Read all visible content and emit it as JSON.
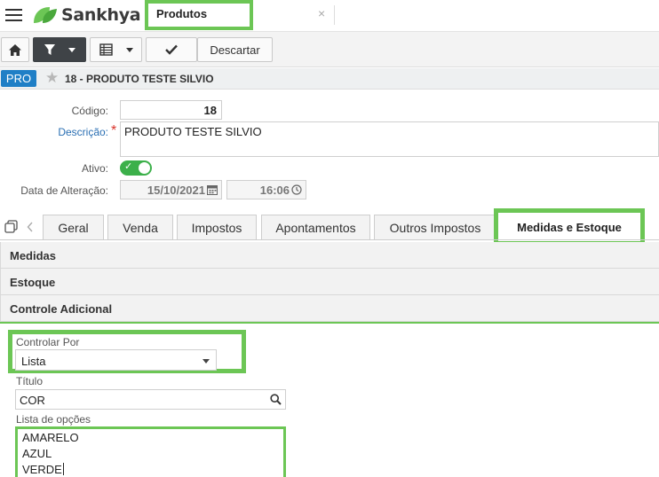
{
  "app": {
    "logo_text": "Sankhya",
    "brand_color": "#6cc655"
  },
  "window_tab": {
    "title": "Produtos",
    "close_glyph": "×"
  },
  "toolbar": {
    "discard_label": "Descartar"
  },
  "record": {
    "badge": "PRO",
    "title": "18 - PRODUTO TESTE SILVIO"
  },
  "form": {
    "codigo": {
      "label": "Código:",
      "value": "18"
    },
    "descricao": {
      "label": "Descrição:",
      "required_mark": "*",
      "value": "PRODUTO TESTE SILVIO"
    },
    "ativo": {
      "label": "Ativo:",
      "checked": true
    },
    "data_alteracao": {
      "label": "Data de Alteração:",
      "date": "15/10/2021",
      "time": "16:06"
    }
  },
  "tabs": [
    "Geral",
    "Venda",
    "Impostos",
    "Apontamentos",
    "Outros Impostos",
    "Medidas e Estoque"
  ],
  "active_tab": "Medidas e Estoque",
  "sections": [
    "Medidas",
    "Estoque",
    "Controle Adicional"
  ],
  "controle": {
    "controlar_por_label": "Controlar Por",
    "controlar_por_value": "Lista",
    "titulo_label": "Título",
    "titulo_value": "COR",
    "lista_label": "Lista de opções",
    "options": [
      "AMARELO",
      "AZUL",
      "VERDE"
    ]
  }
}
